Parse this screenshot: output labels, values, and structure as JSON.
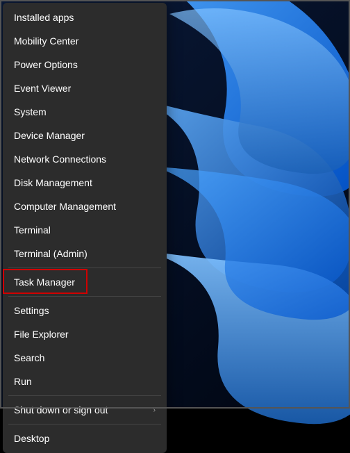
{
  "menu": {
    "items": [
      {
        "label": "Installed apps",
        "hasSubmenu": false
      },
      {
        "label": "Mobility Center",
        "hasSubmenu": false
      },
      {
        "label": "Power Options",
        "hasSubmenu": false
      },
      {
        "label": "Event Viewer",
        "hasSubmenu": false
      },
      {
        "label": "System",
        "hasSubmenu": false
      },
      {
        "label": "Device Manager",
        "hasSubmenu": false
      },
      {
        "label": "Network Connections",
        "hasSubmenu": false
      },
      {
        "label": "Disk Management",
        "hasSubmenu": false
      },
      {
        "label": "Computer Management",
        "hasSubmenu": false
      },
      {
        "label": "Terminal",
        "hasSubmenu": false
      },
      {
        "label": "Terminal (Admin)",
        "hasSubmenu": false
      },
      {
        "separator": true
      },
      {
        "label": "Task Manager",
        "hasSubmenu": false,
        "highlighted": true
      },
      {
        "separator": true
      },
      {
        "label": "Settings",
        "hasSubmenu": false
      },
      {
        "label": "File Explorer",
        "hasSubmenu": false
      },
      {
        "label": "Search",
        "hasSubmenu": false
      },
      {
        "label": "Run",
        "hasSubmenu": false
      },
      {
        "separator": true
      },
      {
        "label": "Shut down or sign out",
        "hasSubmenu": true
      },
      {
        "separator": true
      },
      {
        "label": "Desktop",
        "hasSubmenu": false
      }
    ]
  }
}
